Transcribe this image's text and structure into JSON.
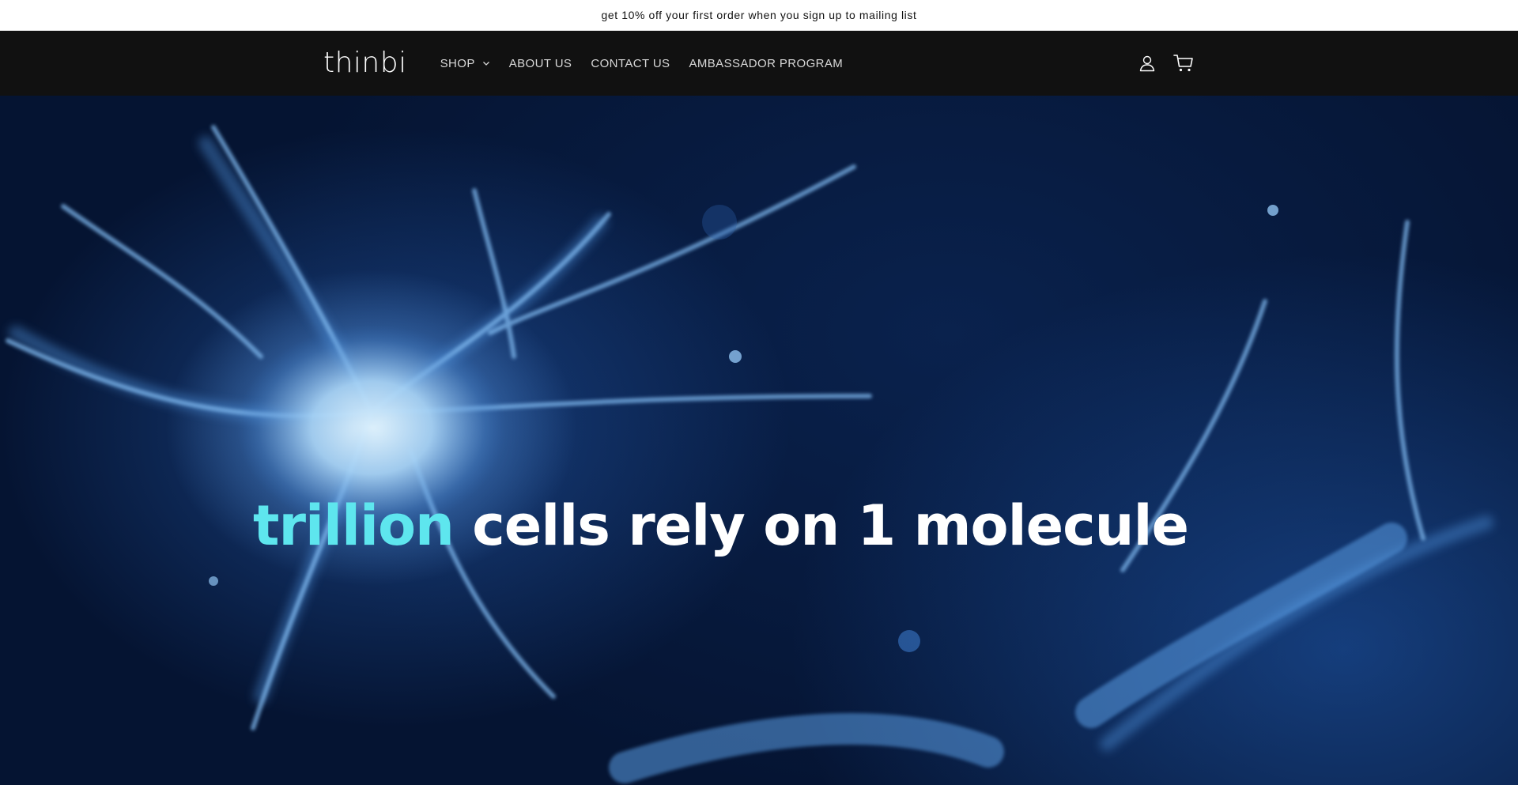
{
  "announcement": {
    "text": "get 10% off your first order when you sign up to mailing list"
  },
  "header": {
    "logo": "thinbi",
    "nav": [
      {
        "label": "SHOP",
        "has_dropdown": true
      },
      {
        "label": "ABOUT US"
      },
      {
        "label": "CONTACT US"
      },
      {
        "label": "AMBASSADOR PROGRAM"
      }
    ],
    "icons": [
      "account-icon",
      "cart-icon"
    ]
  },
  "hero": {
    "headline_accent": "trillion",
    "headline_rest": " cells rely on 1 molecule",
    "accent_color": "#5ee6ee"
  }
}
